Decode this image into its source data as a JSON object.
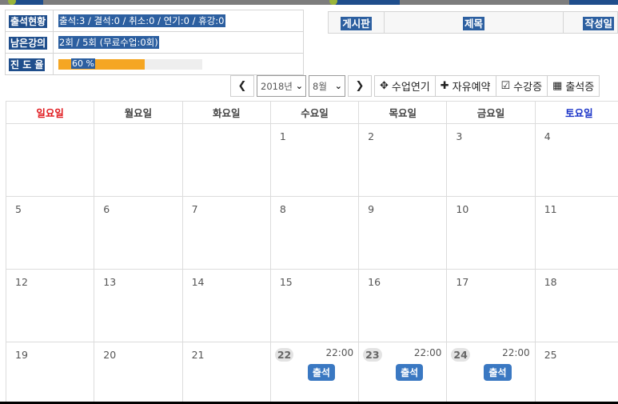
{
  "status": {
    "attendance_label": "출석현황",
    "attendance_value": "출석:3 / 결석:0 / 취소:0 / 연기:0 / 휴강:0",
    "remaining_label": "남은강의",
    "remaining_value": "2회 / 5회 (무료수업:0회)",
    "progress_label": "진 도 율",
    "progress_text": "60 %",
    "progress_percent": 60
  },
  "board": {
    "col_board": "게시판",
    "col_title": "제목",
    "col_author": "작성일"
  },
  "toolbar": {
    "prev_icon": "chevron-left-icon",
    "next_icon": "chevron-right-icon",
    "year_select": "2018년",
    "month_select": "8월",
    "postpone_label": "수업연기",
    "free_reserve_label": "자유예약",
    "certificate_label": "수강증",
    "attendance_cert_label": "출석증"
  },
  "calendar": {
    "weekdays": [
      "일요일",
      "월요일",
      "화요일",
      "수요일",
      "목요일",
      "금요일",
      "토요일"
    ],
    "weeks": [
      [
        "",
        "",
        "",
        "1",
        "2",
        "3",
        "4"
      ],
      [
        "5",
        "6",
        "7",
        "8",
        "9",
        "10",
        "11"
      ],
      [
        "12",
        "13",
        "14",
        "15",
        "16",
        "17",
        "18"
      ],
      [
        "19",
        "20",
        "21",
        "22",
        "23",
        "24",
        "25"
      ]
    ],
    "events": [
      {
        "day": "22",
        "time": "22:00",
        "badge": "출석"
      },
      {
        "day": "23",
        "time": "22:00",
        "badge": "출석"
      },
      {
        "day": "24",
        "time": "22:00",
        "badge": "출석"
      }
    ]
  },
  "colors": {
    "label_bg": "#1f4e8c",
    "progress_fill": "#f5a623",
    "sunday": "#e0191e",
    "saturday": "#1a33c7",
    "badge": "#3a78c2"
  }
}
